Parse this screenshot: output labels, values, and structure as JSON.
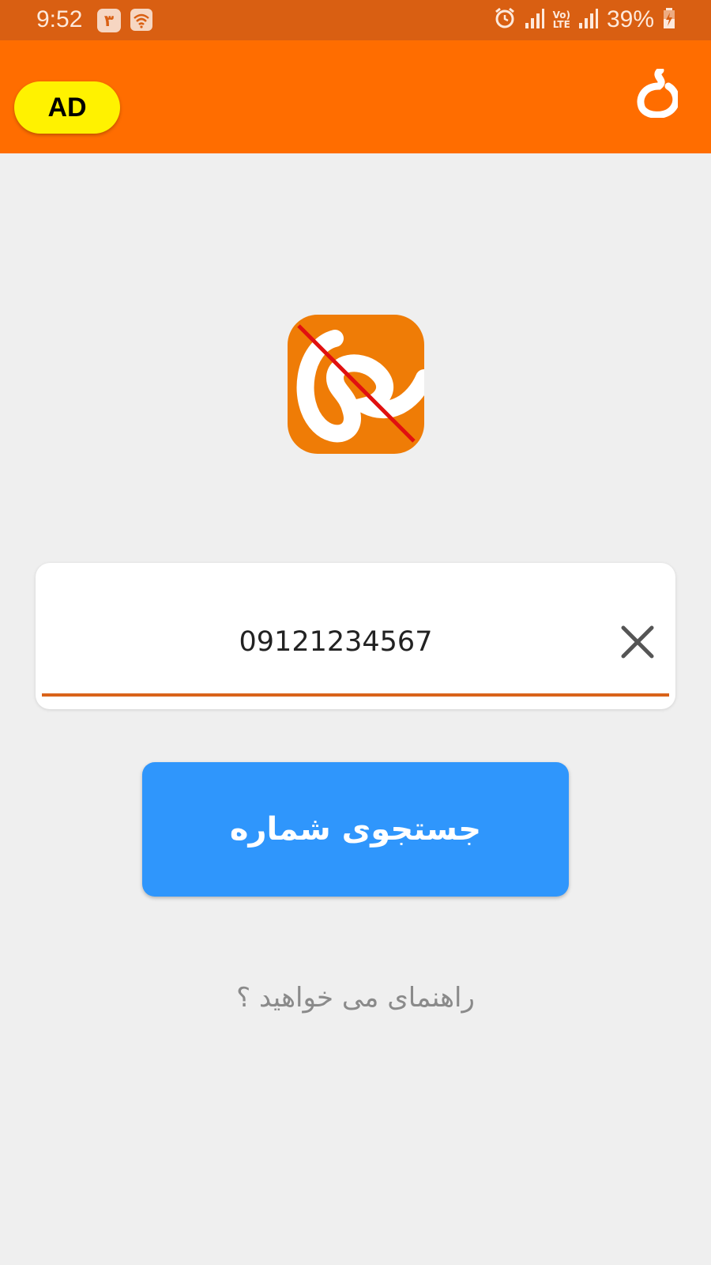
{
  "status_bar": {
    "time": "9:52",
    "notification_badge": "۳",
    "battery": "39%",
    "network_label_top": "Vo)",
    "network_label_bottom": "LTE",
    "icons": [
      "wifi-icon",
      "alarm-icon",
      "signal-icon",
      "battery-charging-icon"
    ]
  },
  "app_bar": {
    "ad_label": "AD",
    "background_color": "#ff6d00",
    "logo_icon": "brand-logo-icon"
  },
  "search": {
    "value": "09121234567",
    "clear_icon": "close-icon",
    "button_label": "جستجوی شماره",
    "button_color": "#2f96fc",
    "accent_color": "#d9631a"
  },
  "help": {
    "link_label": "راهنمای می خواهید ؟"
  }
}
